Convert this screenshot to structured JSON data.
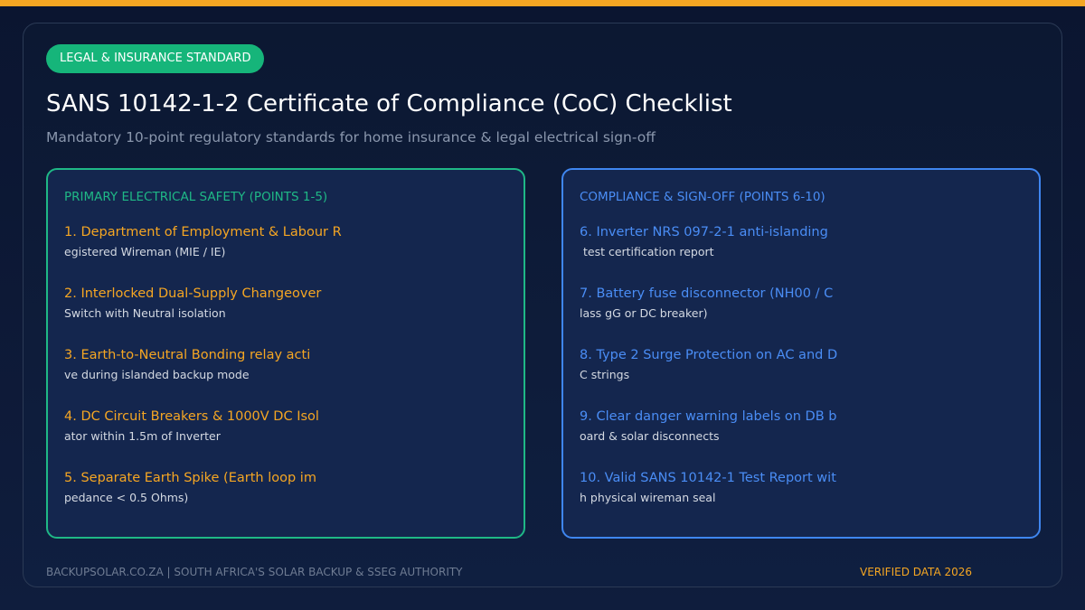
{
  "badge": "LEGAL & INSURANCE STANDARD",
  "title": "SANS 10142-1-2 Certificate of Compliance (CoC) Checklist",
  "subtitle": "Mandatory 10-point regulatory standards for home insurance & legal electrical sign-off",
  "left_panel": {
    "heading": "PRIMARY ELECTRICAL SAFETY (POINTS 1-5)",
    "items": [
      {
        "title": "1. Department of Employment & Labour R",
        "desc": "egistered Wireman (MIE / IE)"
      },
      {
        "title": "2. Interlocked Dual-Supply Changeover",
        "desc": "Switch with Neutral isolation"
      },
      {
        "title": "3. Earth-to-Neutral Bonding relay acti",
        "desc": "ve during islanded backup mode"
      },
      {
        "title": "4. DC Circuit Breakers & 1000V DC Isol",
        "desc": "ator within 1.5m of Inverter"
      },
      {
        "title": "5. Separate Earth Spike (Earth loop im",
        "desc": "pedance < 0.5 Ohms)"
      }
    ]
  },
  "right_panel": {
    "heading": "COMPLIANCE & SIGN-OFF (POINTS 6-10)",
    "items": [
      {
        "title": "6. Inverter NRS 097-2-1 anti-islanding",
        "desc": " test certification report"
      },
      {
        "title": "7. Battery fuse disconnector (NH00 / C",
        "desc": "lass gG or DC breaker)"
      },
      {
        "title": "8. Type 2 Surge Protection on AC and D",
        "desc": "C strings"
      },
      {
        "title": "9. Clear danger warning labels on DB b",
        "desc": "oard & solar disconnects"
      },
      {
        "title": "10. Valid SANS 10142-1 Test Report wit",
        "desc": "h physical wireman seal"
      }
    ]
  },
  "footer": {
    "left": "BACKUPSOLAR.CO.ZA | SOUTH AFRICA'S SOLAR BACKUP & SSEG AUTHORITY",
    "right": "VERIFIED DATA 2026"
  },
  "colors": {
    "accent_orange": "#f5a623",
    "accent_green": "#1fb886",
    "accent_blue": "#4a8df5",
    "background": "#0c1832"
  }
}
